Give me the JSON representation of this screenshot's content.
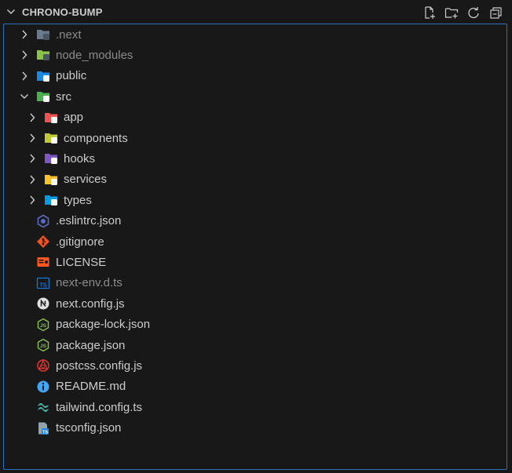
{
  "explorer": {
    "title": "CHRONO-BUMP",
    "actions": [
      {
        "name": "new-file-button",
        "icon": "new-file-icon"
      },
      {
        "name": "new-folder-button",
        "icon": "new-folder-icon"
      },
      {
        "name": "refresh-button",
        "icon": "refresh-icon"
      },
      {
        "name": "collapse-all-button",
        "icon": "collapse-all-icon"
      }
    ]
  },
  "tree": [
    {
      "label": ".next",
      "type": "folder",
      "depth": 0,
      "expanded": false,
      "dim": true,
      "icon": "next-folder-icon",
      "color": "#6b7a8c"
    },
    {
      "label": "node_modules",
      "type": "folder",
      "depth": 0,
      "expanded": false,
      "dim": true,
      "icon": "node-folder-icon",
      "color": "#8bc34a"
    },
    {
      "label": "public",
      "type": "folder",
      "depth": 0,
      "expanded": false,
      "dim": false,
      "icon": "public-folder-icon",
      "color": "#1e88e5"
    },
    {
      "label": "src",
      "type": "folder",
      "depth": 0,
      "expanded": true,
      "dim": false,
      "icon": "src-folder-icon",
      "color": "#4caf50"
    },
    {
      "label": "app",
      "type": "folder",
      "depth": 1,
      "expanded": false,
      "dim": false,
      "icon": "app-folder-icon",
      "color": "#ef5350"
    },
    {
      "label": "components",
      "type": "folder",
      "depth": 1,
      "expanded": false,
      "dim": false,
      "icon": "components-folder-icon",
      "color": "#c0ca33"
    },
    {
      "label": "hooks",
      "type": "folder",
      "depth": 1,
      "expanded": false,
      "dim": false,
      "icon": "hooks-folder-icon",
      "color": "#7e57c2"
    },
    {
      "label": "services",
      "type": "folder",
      "depth": 1,
      "expanded": false,
      "dim": false,
      "icon": "services-folder-icon",
      "color": "#fbc02d"
    },
    {
      "label": "types",
      "type": "folder",
      "depth": 1,
      "expanded": false,
      "dim": false,
      "icon": "types-folder-icon",
      "color": "#039be5"
    },
    {
      "label": ".eslintrc.json",
      "type": "file",
      "depth": 0,
      "dim": false,
      "icon": "eslint-icon",
      "color": "#5c6bc0"
    },
    {
      "label": ".gitignore",
      "type": "file",
      "depth": 0,
      "dim": false,
      "icon": "git-icon",
      "color": "#f4511e"
    },
    {
      "label": "LICENSE",
      "type": "file",
      "depth": 0,
      "dim": false,
      "icon": "license-icon",
      "color": "#ff5722"
    },
    {
      "label": "next-env.d.ts",
      "type": "file",
      "depth": 0,
      "dim": true,
      "icon": "typescript-def-icon",
      "color": "#1976d2"
    },
    {
      "label": "next.config.js",
      "type": "file",
      "depth": 0,
      "dim": false,
      "icon": "nextjs-icon",
      "color": "#e0e0e0"
    },
    {
      "label": "package-lock.json",
      "type": "file",
      "depth": 0,
      "dim": false,
      "icon": "nodejs-icon",
      "color": "#8bc34a"
    },
    {
      "label": "package.json",
      "type": "file",
      "depth": 0,
      "dim": false,
      "icon": "nodejs-icon",
      "color": "#8bc34a"
    },
    {
      "label": "postcss.config.js",
      "type": "file",
      "depth": 0,
      "dim": false,
      "icon": "postcss-icon",
      "color": "#e53935"
    },
    {
      "label": "README.md",
      "type": "file",
      "depth": 0,
      "dim": false,
      "icon": "info-icon",
      "color": "#42a5f5"
    },
    {
      "label": "tailwind.config.ts",
      "type": "file",
      "depth": 0,
      "dim": false,
      "icon": "tailwind-icon",
      "color": "#4db6ac"
    },
    {
      "label": "tsconfig.json",
      "type": "file",
      "depth": 0,
      "dim": false,
      "icon": "tsconfig-icon",
      "color": "#1e88e5"
    }
  ],
  "colors": {
    "background": "#181818",
    "focus_border": "#2c6fb9",
    "text": "#cccccc",
    "dim_text": "#8b8b8b"
  }
}
